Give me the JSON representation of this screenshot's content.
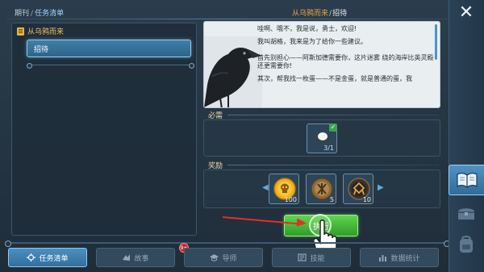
{
  "breadcrumb": {
    "root": "期刊",
    "sep": "/",
    "current": "任务清单"
  },
  "left_panel": {
    "chapter_title": "从乌鸦而来",
    "quest_item": "招待"
  },
  "quest_header": {
    "name": "从乌鸦而来",
    "sep": "/",
    "page": "招待"
  },
  "dialogue": {
    "lines": [
      "哇啊、哦不，我是说，勇士，欢迎!",
      "我叫胡格，我来是为了给你一些建议。",
      "首先别担心——阿斯加德需要你，这片迷雾 绕的海岸比英灵殿还更需要你!",
      "其次，帮我找一枚蛋——不是金蛋，就是普通的蛋，我"
    ]
  },
  "required": {
    "label": "必需",
    "item": {
      "icon": "egg-icon",
      "count": "3/1",
      "completed": true
    }
  },
  "rewards": {
    "label": "奖励",
    "items": [
      {
        "icon": "gold-skull-coin-icon",
        "count": "100"
      },
      {
        "icon": "bronze-rune-coin-icon",
        "count": "5"
      },
      {
        "icon": "dark-rune-coin-icon",
        "count": "10"
      }
    ]
  },
  "execute_button": {
    "label": "执行"
  },
  "bottom_tabs": [
    {
      "label": "任务清单",
      "icon": "quest-list-icon",
      "active": true
    },
    {
      "label": "故事",
      "icon": "story-icon",
      "active": false,
      "badge": "9+"
    },
    {
      "label": "导师",
      "icon": "mentor-icon",
      "active": false
    },
    {
      "label": "技能",
      "icon": "skills-icon",
      "active": false
    },
    {
      "label": "数据统计",
      "icon": "stats-icon",
      "active": false
    }
  ],
  "sidebar": {
    "close_icon": "✕",
    "tabs": [
      {
        "icon": "book-icon",
        "active": true
      },
      {
        "icon": "chest-icon",
        "active": false
      },
      {
        "icon": "backpack-icon",
        "active": false
      }
    ]
  },
  "colors": {
    "accent_blue": "#4c8fc0",
    "quest_orange": "#e9a441",
    "execute_green": "#3fb337",
    "arrow_red": "#e0302a"
  }
}
